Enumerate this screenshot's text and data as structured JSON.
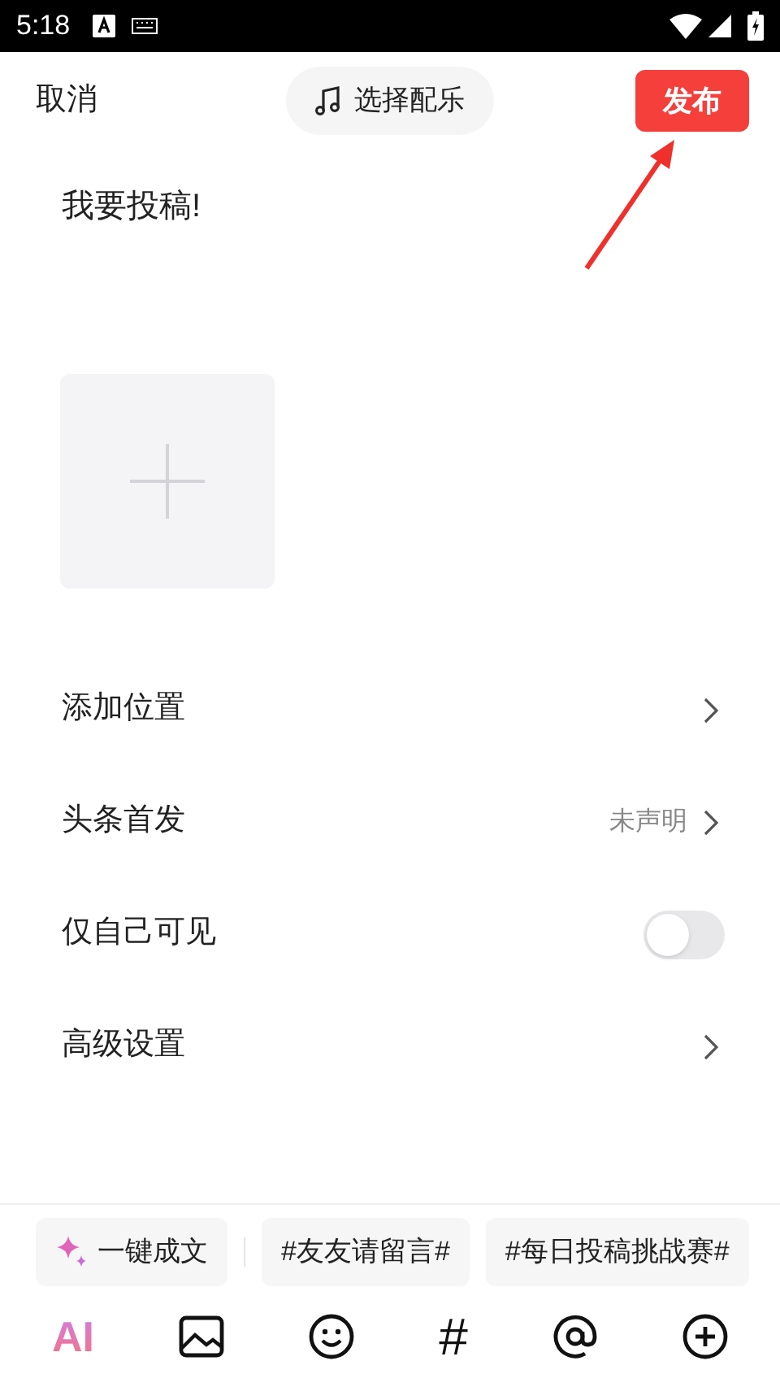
{
  "status_bar": {
    "time": "5:18"
  },
  "header": {
    "cancel": "取消",
    "music": "选择配乐",
    "publish": "发布"
  },
  "post": {
    "text": "我要投稿!"
  },
  "settings": [
    {
      "kind": "link",
      "label": "添加位置"
    },
    {
      "kind": "value",
      "label": "头条首发",
      "value": "未声明"
    },
    {
      "kind": "toggle",
      "label": "仅自己可见",
      "on": false
    },
    {
      "kind": "link",
      "label": "高级设置"
    }
  ],
  "chips": [
    {
      "kind": "ai",
      "label": "一键成文"
    },
    {
      "kind": "topic",
      "label": "#友友请留言#"
    },
    {
      "kind": "topic",
      "label": "#每日投稿挑战赛#"
    }
  ],
  "toolbar": [
    {
      "kind": "ai",
      "label": "AI"
    },
    {
      "kind": "image"
    },
    {
      "kind": "emoji"
    },
    {
      "kind": "hash",
      "label": "#"
    },
    {
      "kind": "at"
    },
    {
      "kind": "plus"
    }
  ]
}
